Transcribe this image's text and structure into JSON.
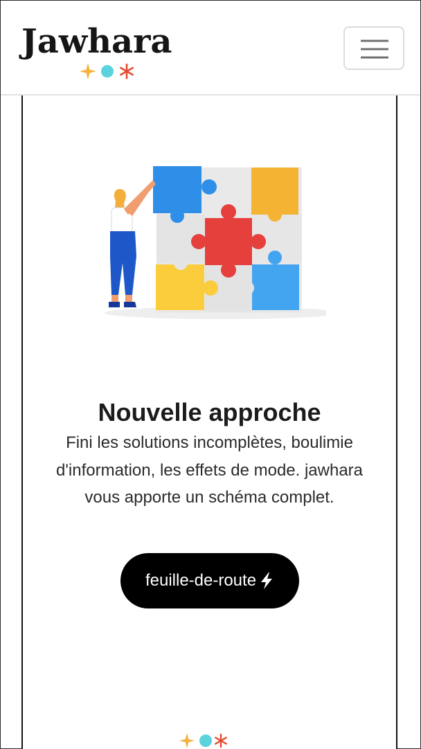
{
  "brand": {
    "name": "Jawhara",
    "accent_colors": {
      "star": "#F2B441",
      "dot": "#5BD3DC",
      "asterisk": "#E5492F"
    }
  },
  "header": {
    "menu_icon": "hamburger-icon"
  },
  "hero": {
    "illustration": "puzzle-illustration",
    "title": "Nouvelle approche",
    "description": "Fini les solutions incomplètes, boulimie d'information, les effets de mode. jawhara vous apporte un schéma complet.",
    "cta": {
      "label": "feuille-de-route",
      "icon": "lightning-icon"
    }
  },
  "footer_marks": {
    "icons": [
      "star-icon",
      "dot-icon",
      "asterisk-icon"
    ]
  }
}
